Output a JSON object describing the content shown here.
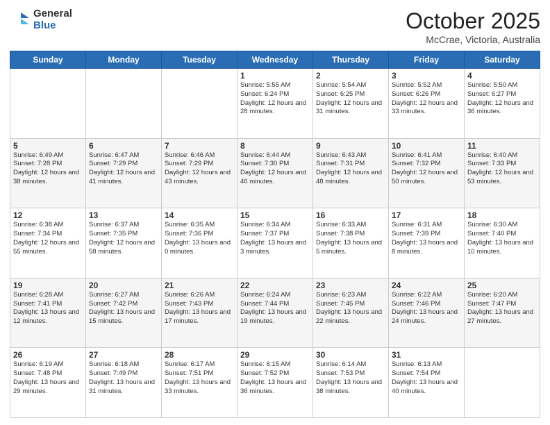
{
  "logo": {
    "general": "General",
    "blue": "Blue"
  },
  "header": {
    "month": "October 2025",
    "location": "McCrae, Victoria, Australia"
  },
  "days_of_week": [
    "Sunday",
    "Monday",
    "Tuesday",
    "Wednesday",
    "Thursday",
    "Friday",
    "Saturday"
  ],
  "weeks": [
    [
      {
        "day": "",
        "info": ""
      },
      {
        "day": "",
        "info": ""
      },
      {
        "day": "",
        "info": ""
      },
      {
        "day": "1",
        "info": "Sunrise: 5:55 AM\nSunset: 6:24 PM\nDaylight: 12 hours\nand 28 minutes."
      },
      {
        "day": "2",
        "info": "Sunrise: 5:54 AM\nSunset: 6:25 PM\nDaylight: 12 hours\nand 31 minutes."
      },
      {
        "day": "3",
        "info": "Sunrise: 5:52 AM\nSunset: 6:26 PM\nDaylight: 12 hours\nand 33 minutes."
      },
      {
        "day": "4",
        "info": "Sunrise: 5:50 AM\nSunset: 6:27 PM\nDaylight: 12 hours\nand 36 minutes."
      }
    ],
    [
      {
        "day": "5",
        "info": "Sunrise: 6:49 AM\nSunset: 7:28 PM\nDaylight: 12 hours\nand 38 minutes."
      },
      {
        "day": "6",
        "info": "Sunrise: 6:47 AM\nSunset: 7:29 PM\nDaylight: 12 hours\nand 41 minutes."
      },
      {
        "day": "7",
        "info": "Sunrise: 6:46 AM\nSunset: 7:29 PM\nDaylight: 12 hours\nand 43 minutes."
      },
      {
        "day": "8",
        "info": "Sunrise: 6:44 AM\nSunset: 7:30 PM\nDaylight: 12 hours\nand 46 minutes."
      },
      {
        "day": "9",
        "info": "Sunrise: 6:43 AM\nSunset: 7:31 PM\nDaylight: 12 hours\nand 48 minutes."
      },
      {
        "day": "10",
        "info": "Sunrise: 6:41 AM\nSunset: 7:32 PM\nDaylight: 12 hours\nand 50 minutes."
      },
      {
        "day": "11",
        "info": "Sunrise: 6:40 AM\nSunset: 7:33 PM\nDaylight: 12 hours\nand 53 minutes."
      }
    ],
    [
      {
        "day": "12",
        "info": "Sunrise: 6:38 AM\nSunset: 7:34 PM\nDaylight: 12 hours\nand 55 minutes."
      },
      {
        "day": "13",
        "info": "Sunrise: 6:37 AM\nSunset: 7:35 PM\nDaylight: 12 hours\nand 58 minutes."
      },
      {
        "day": "14",
        "info": "Sunrise: 6:35 AM\nSunset: 7:36 PM\nDaylight: 13 hours\nand 0 minutes."
      },
      {
        "day": "15",
        "info": "Sunrise: 6:34 AM\nSunset: 7:37 PM\nDaylight: 13 hours\nand 3 minutes."
      },
      {
        "day": "16",
        "info": "Sunrise: 6:33 AM\nSunset: 7:38 PM\nDaylight: 13 hours\nand 5 minutes."
      },
      {
        "day": "17",
        "info": "Sunrise: 6:31 AM\nSunset: 7:39 PM\nDaylight: 13 hours\nand 8 minutes."
      },
      {
        "day": "18",
        "info": "Sunrise: 6:30 AM\nSunset: 7:40 PM\nDaylight: 13 hours\nand 10 minutes."
      }
    ],
    [
      {
        "day": "19",
        "info": "Sunrise: 6:28 AM\nSunset: 7:41 PM\nDaylight: 13 hours\nand 12 minutes."
      },
      {
        "day": "20",
        "info": "Sunrise: 6:27 AM\nSunset: 7:42 PM\nDaylight: 13 hours\nand 15 minutes."
      },
      {
        "day": "21",
        "info": "Sunrise: 6:26 AM\nSunset: 7:43 PM\nDaylight: 13 hours\nand 17 minutes."
      },
      {
        "day": "22",
        "info": "Sunrise: 6:24 AM\nSunset: 7:44 PM\nDaylight: 13 hours\nand 19 minutes."
      },
      {
        "day": "23",
        "info": "Sunrise: 6:23 AM\nSunset: 7:45 PM\nDaylight: 13 hours\nand 22 minutes."
      },
      {
        "day": "24",
        "info": "Sunrise: 6:22 AM\nSunset: 7:46 PM\nDaylight: 13 hours\nand 24 minutes."
      },
      {
        "day": "25",
        "info": "Sunrise: 6:20 AM\nSunset: 7:47 PM\nDaylight: 13 hours\nand 27 minutes."
      }
    ],
    [
      {
        "day": "26",
        "info": "Sunrise: 6:19 AM\nSunset: 7:48 PM\nDaylight: 13 hours\nand 29 minutes."
      },
      {
        "day": "27",
        "info": "Sunrise: 6:18 AM\nSunset: 7:49 PM\nDaylight: 13 hours\nand 31 minutes."
      },
      {
        "day": "28",
        "info": "Sunrise: 6:17 AM\nSunset: 7:51 PM\nDaylight: 13 hours\nand 33 minutes."
      },
      {
        "day": "29",
        "info": "Sunrise: 6:15 AM\nSunset: 7:52 PM\nDaylight: 13 hours\nand 36 minutes."
      },
      {
        "day": "30",
        "info": "Sunrise: 6:14 AM\nSunset: 7:53 PM\nDaylight: 13 hours\nand 38 minutes."
      },
      {
        "day": "31",
        "info": "Sunrise: 6:13 AM\nSunset: 7:54 PM\nDaylight: 13 hours\nand 40 minutes."
      },
      {
        "day": "",
        "info": ""
      }
    ]
  ]
}
